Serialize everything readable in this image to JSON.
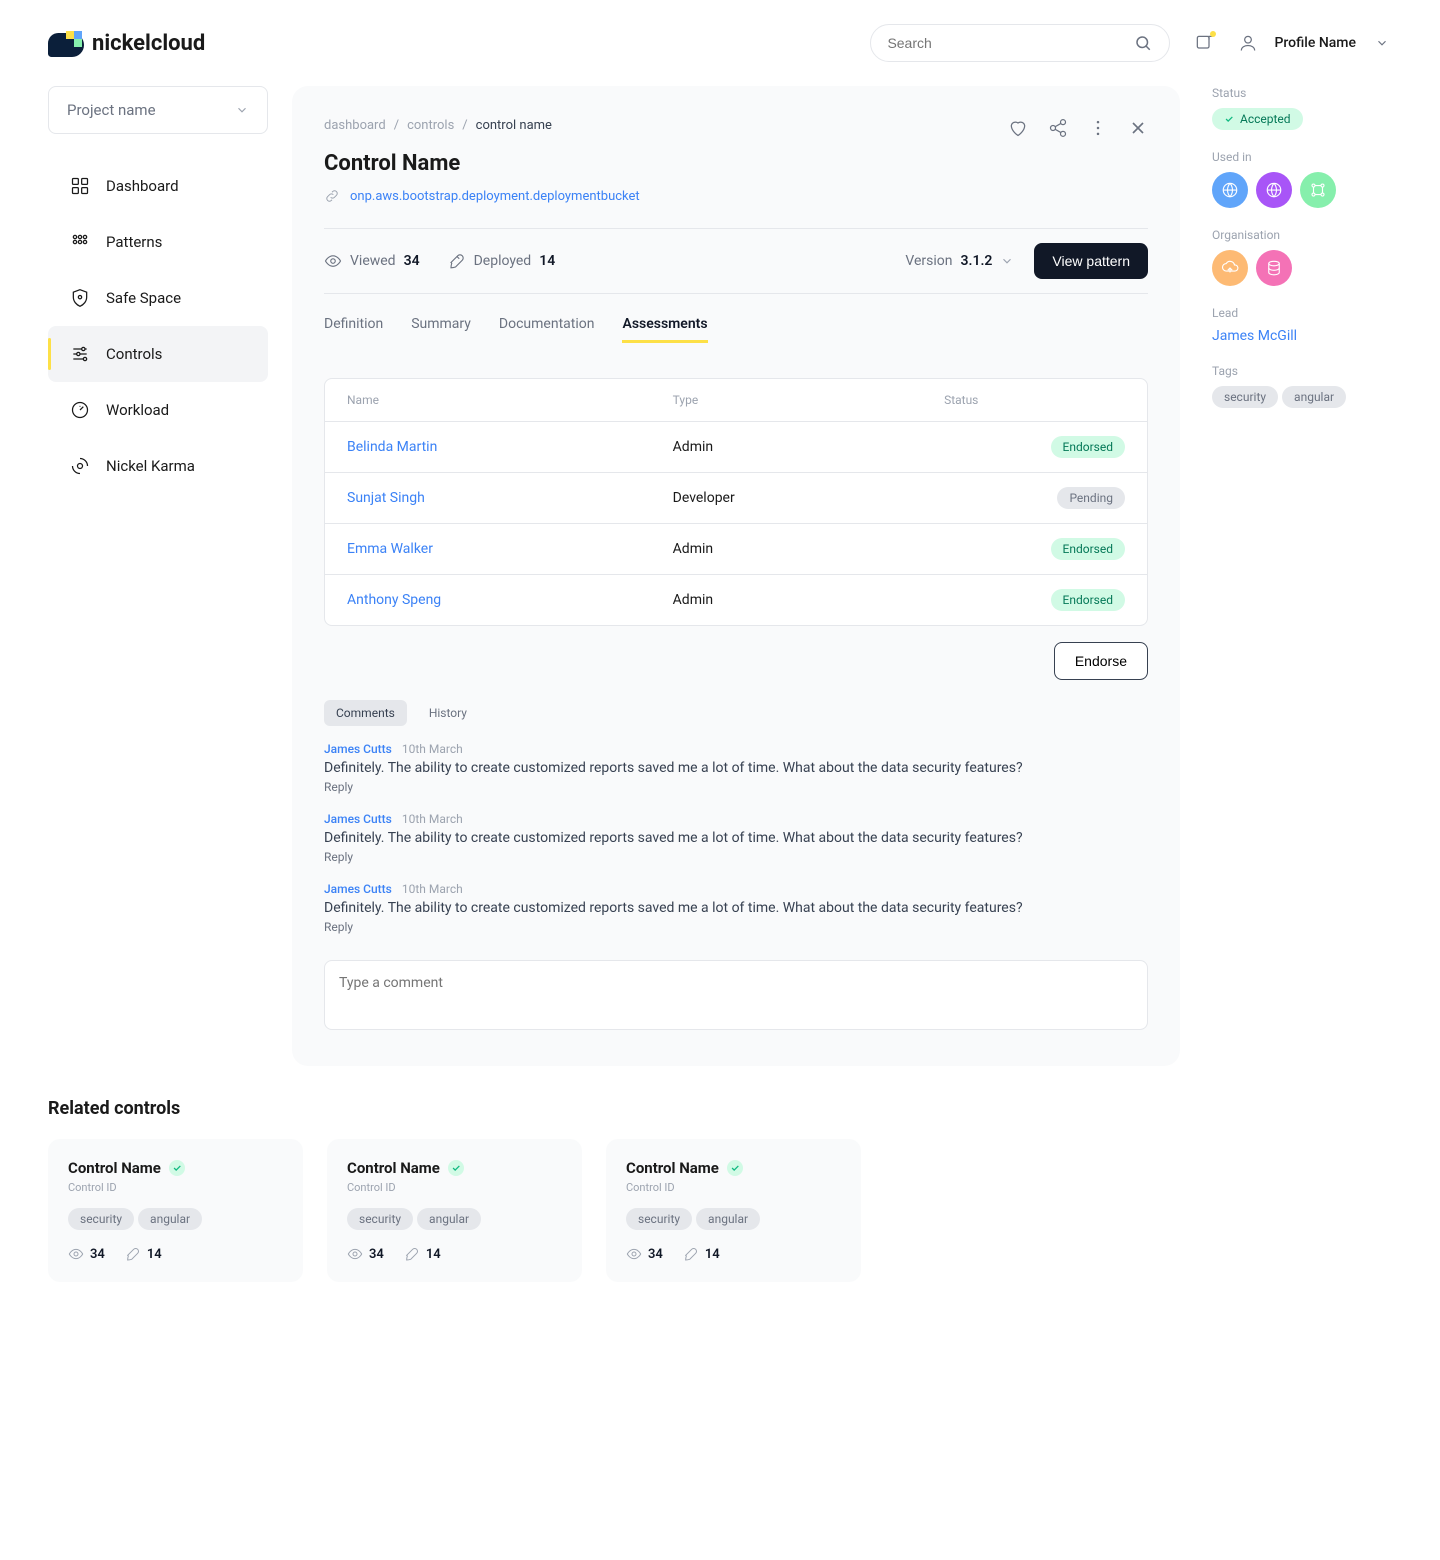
{
  "brand": "nickelcloud",
  "search": {
    "placeholder": "Search"
  },
  "profile": {
    "name": "Profile Name"
  },
  "sidebar": {
    "project_label": "Project name",
    "items": [
      {
        "label": "Dashboard"
      },
      {
        "label": "Patterns"
      },
      {
        "label": "Safe Space"
      },
      {
        "label": "Controls"
      },
      {
        "label": "Workload"
      },
      {
        "label": "Nickel Karma"
      }
    ]
  },
  "breadcrumb": {
    "a": "dashboard",
    "b": "controls",
    "c": "control name"
  },
  "page_title": "Control Name",
  "resource_link": "onp.aws.bootstrap.deployment.deploymentbucket",
  "meta": {
    "viewed_label": "Viewed",
    "viewed_count": "34",
    "deployed_label": "Deployed",
    "deployed_count": "14",
    "version_label": "Version",
    "version_value": "3.1.2",
    "view_pattern": "View pattern"
  },
  "tabs": {
    "definition": "Definition",
    "summary": "Summary",
    "documentation": "Documentation",
    "assessments": "Assessments"
  },
  "table": {
    "head_name": "Name",
    "head_type": "Type",
    "head_status": "Status",
    "rows": [
      {
        "name": "Belinda Martin",
        "type": "Admin",
        "status": "Endorsed",
        "status_kind": "endorsed"
      },
      {
        "name": "Sunjat Singh",
        "type": "Developer",
        "status": "Pending",
        "status_kind": "pending"
      },
      {
        "name": "Emma Walker",
        "type": "Admin",
        "status": "Endorsed",
        "status_kind": "endorsed"
      },
      {
        "name": "Anthony Speng",
        "type": "Admin",
        "status": "Endorsed",
        "status_kind": "endorsed"
      }
    ]
  },
  "endorse_btn": "Endorse",
  "sub_tabs": {
    "comments": "Comments",
    "history": "History"
  },
  "comments": [
    {
      "author": "James Cutts",
      "date": "10th March",
      "body": "Definitely. The ability to create customized reports saved me a lot of time. What about the data security features?",
      "reply": "Reply"
    },
    {
      "author": "James Cutts",
      "date": "10th March",
      "body": "Definitely. The ability to create customized reports saved me a lot of time. What about the data security features?",
      "reply": "Reply"
    },
    {
      "author": "James Cutts",
      "date": "10th March",
      "body": "Definitely. The ability to create customized reports saved me a lot of time. What about the data security features?",
      "reply": "Reply"
    }
  ],
  "comment_placeholder": "Type a comment",
  "right": {
    "status_label": "Status",
    "status_value": "Accepted",
    "usedin_label": "Used in",
    "org_label": "Organisation",
    "lead_label": "Lead",
    "lead_value": "James McGill",
    "tags_label": "Tags",
    "tags": [
      "security",
      "angular"
    ]
  },
  "related": {
    "title": "Related controls",
    "cards": [
      {
        "title": "Control Name",
        "sub": "Control ID",
        "tags": [
          "security",
          "angular"
        ],
        "views": "34",
        "deploys": "14"
      },
      {
        "title": "Control Name",
        "sub": "Control ID",
        "tags": [
          "security",
          "angular"
        ],
        "views": "34",
        "deploys": "14"
      },
      {
        "title": "Control Name",
        "sub": "Control ID",
        "tags": [
          "security",
          "angular"
        ],
        "views": "34",
        "deploys": "14"
      }
    ]
  }
}
